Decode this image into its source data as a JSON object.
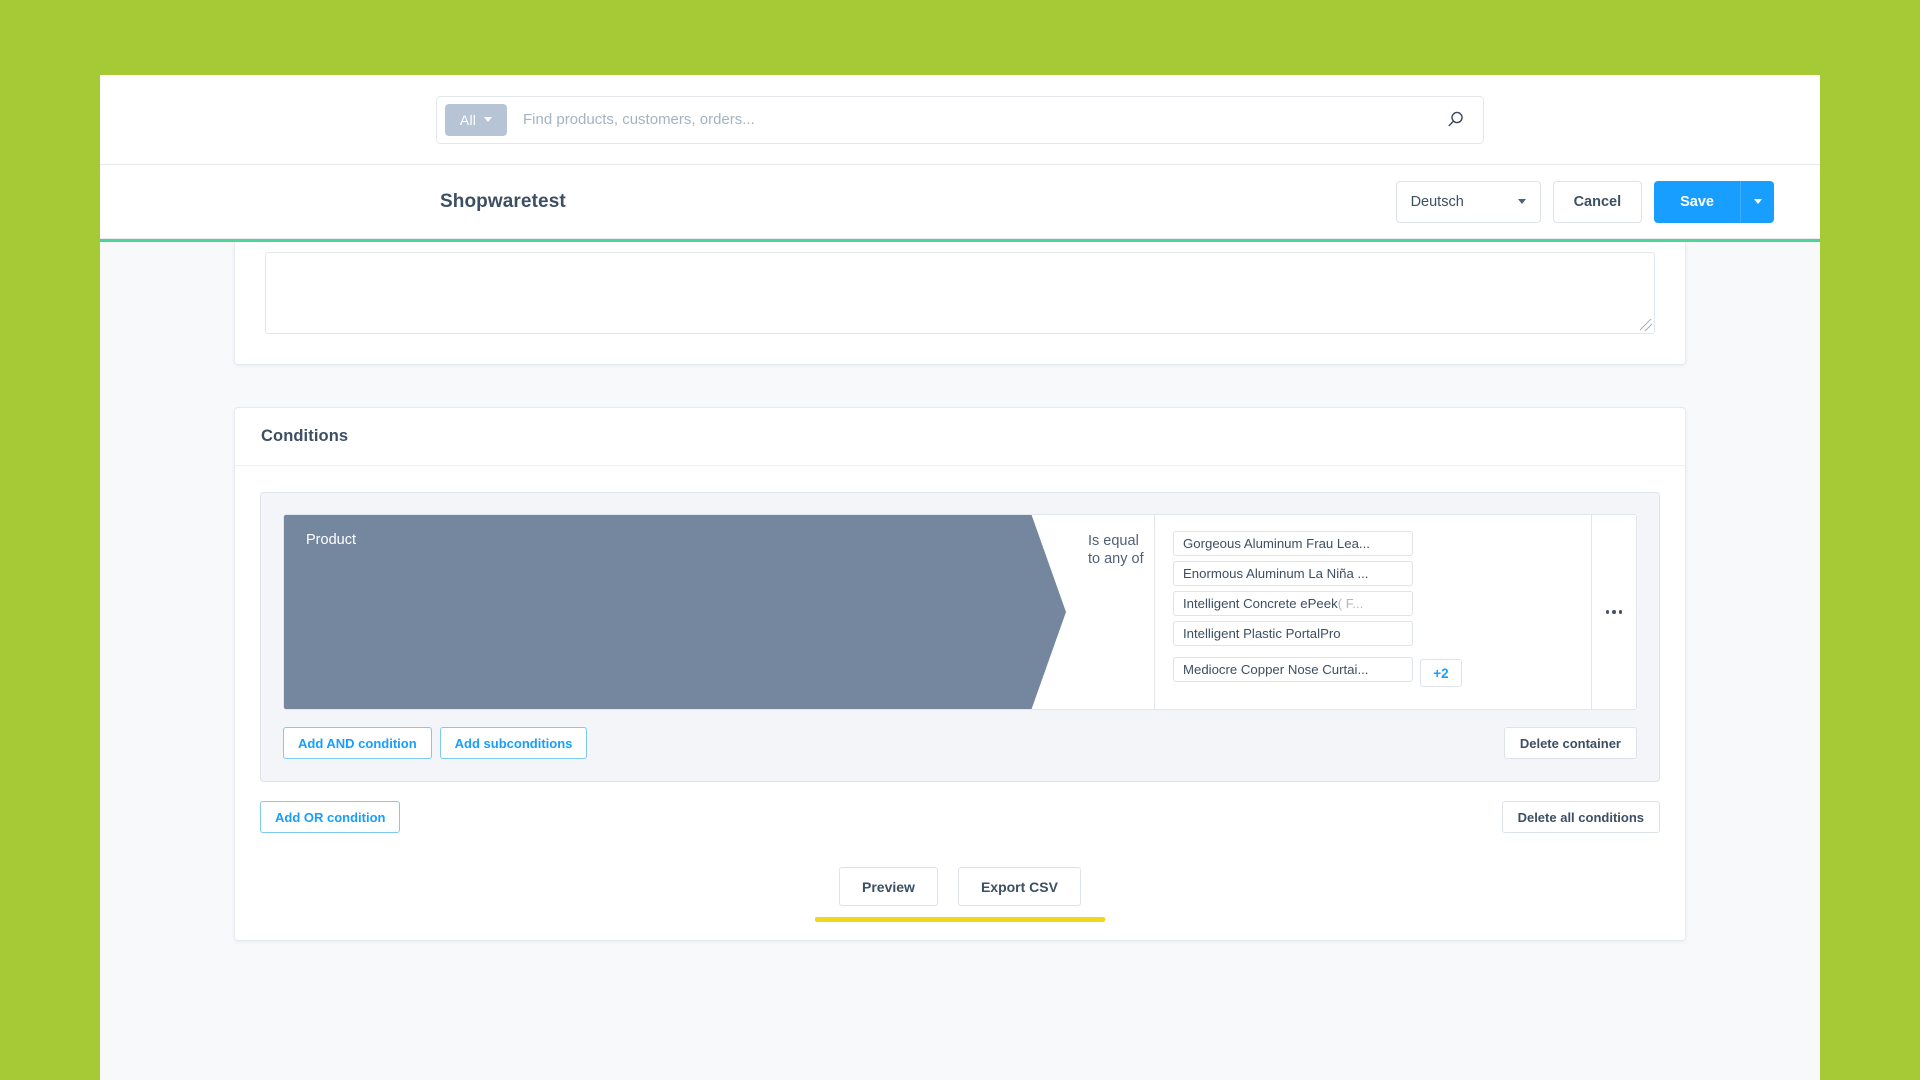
{
  "window": {
    "background_accent": "#a6c936",
    "content_background": "#f7f9fb"
  },
  "search": {
    "scope_label": "All",
    "placeholder": "Find products, customers, orders...",
    "value": "",
    "icon": "search-icon",
    "scope_icon": "chevron-down-icon"
  },
  "smartbar": {
    "title": "Shopwaretest",
    "language": {
      "selected": "Deutsch",
      "icon": "chevron-down-icon"
    },
    "cancel_label": "Cancel",
    "save_label": "Save",
    "save_caret_icon": "chevron-down-icon",
    "accent_color": "#4dd599",
    "save_color": "#189eff"
  },
  "description_card": {
    "textarea_value": "",
    "resize_handle": "resize-grip-icon"
  },
  "conditions": {
    "title": "Conditions",
    "or_container": {
      "condition": {
        "field_label": "Product",
        "field_color": "#75879e",
        "operator_label": "Is equal to any of",
        "values": [
          {
            "text": "Gorgeous Aluminum Frau Lea...",
            "muted": ""
          },
          {
            "text": "Enormous Aluminum La Niña ...",
            "muted": ""
          },
          {
            "text": "Intelligent Concrete ePeek ",
            "muted": "( F..."
          },
          {
            "text": "Intelligent Plastic PortalPro",
            "muted": ""
          },
          {
            "text": "Mediocre Copper Nose Curtai...",
            "muted": ""
          }
        ],
        "more_badge": "+2",
        "more_badge_color": "#189eff",
        "context_menu_icon": "ellipsis-icon"
      },
      "add_and_label": "Add AND condition",
      "add_subconditions_label": "Add subconditions",
      "delete_container_label": "Delete container"
    },
    "add_or_label": "Add OR condition",
    "delete_all_label": "Delete all conditions"
  },
  "footer": {
    "preview_label": "Preview",
    "export_label": "Export CSV",
    "underline_color": "#edd81e"
  }
}
